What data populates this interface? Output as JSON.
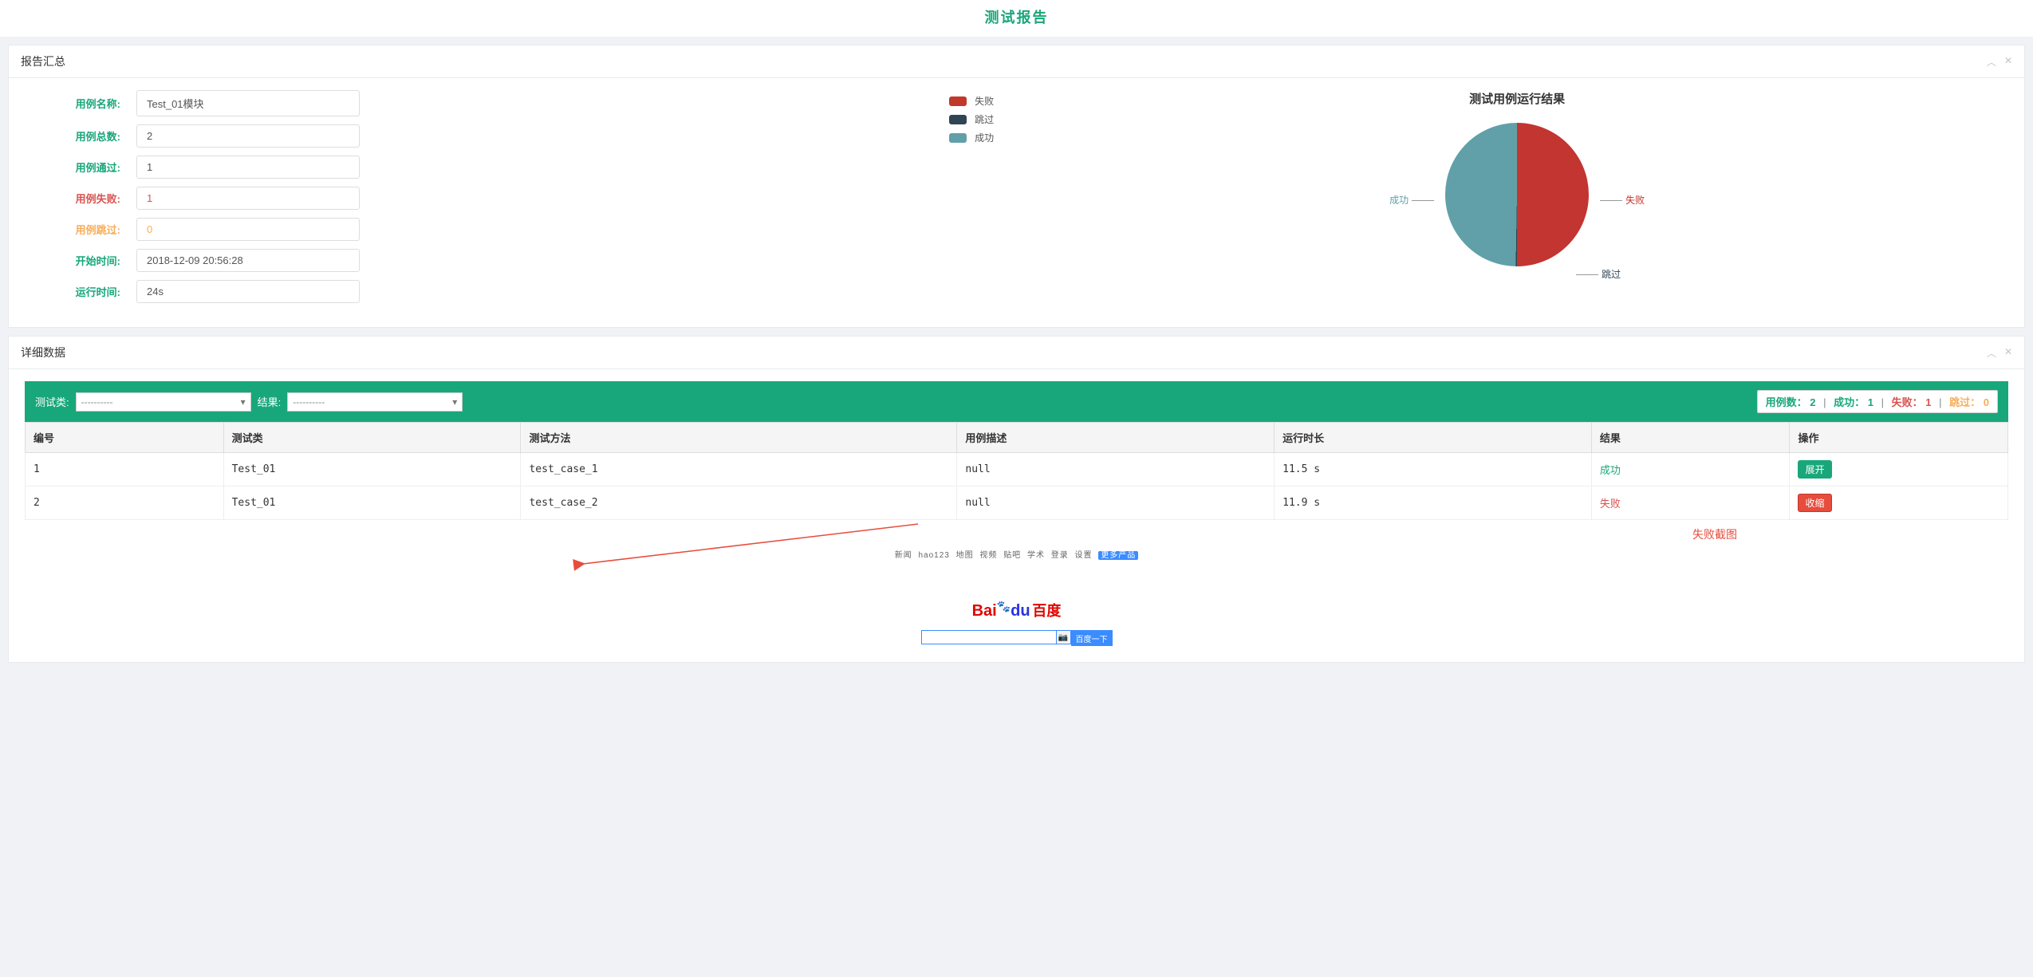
{
  "page_title": "测试报告",
  "panels": {
    "summary": "报告汇总",
    "detail": "详细数据"
  },
  "summary_fields": {
    "case_name": {
      "label": "用例名称:",
      "value": "Test_01模块",
      "label_cls": "lbl-green"
    },
    "case_total": {
      "label": "用例总数:",
      "value": "2",
      "label_cls": "lbl-green"
    },
    "case_pass": {
      "label": "用例通过:",
      "value": "1",
      "label_cls": "lbl-green"
    },
    "case_fail": {
      "label": "用例失败:",
      "value": "1",
      "label_cls": "lbl-red",
      "value_cls": "val-red"
    },
    "case_skip": {
      "label": "用例跳过:",
      "value": "0",
      "label_cls": "lbl-orange",
      "value_cls": "val-orange"
    },
    "start_time": {
      "label": "开始时间:",
      "value": "2018-12-09 20:56:28",
      "label_cls": "lbl-green"
    },
    "run_time": {
      "label": "运行时间:",
      "value": "24s",
      "label_cls": "lbl-green"
    }
  },
  "legend": {
    "fail": "失败",
    "skip": "跳过",
    "pass": "成功"
  },
  "chart": {
    "title": "测试用例运行结果",
    "label_fail": "失败",
    "label_pass": "成功",
    "label_skip": "跳过"
  },
  "chart_data": {
    "type": "pie",
    "title": "测试用例运行结果",
    "series": [
      {
        "name": "失败",
        "value": 1,
        "color": "#c23531"
      },
      {
        "name": "跳过",
        "value": 0,
        "color": "#2f4554"
      },
      {
        "name": "成功",
        "value": 1,
        "color": "#61a0a8"
      }
    ]
  },
  "filters": {
    "class_label": "测试类:",
    "class_placeholder": "----------",
    "result_label": "结果:",
    "result_placeholder": "----------"
  },
  "counters": {
    "total_label": "用例数：",
    "total_value": "2",
    "pass_label": "成功：",
    "pass_value": "1",
    "fail_label": "失败：",
    "fail_value": "1",
    "skip_label": "跳过：",
    "skip_value": "0"
  },
  "table": {
    "headers": {
      "idx": "编号",
      "cls": "测试类",
      "method": "测试方法",
      "desc": "用例描述",
      "duration": "运行时长",
      "result": "结果",
      "action": "操作"
    },
    "rows": [
      {
        "idx": "1",
        "cls": "Test_01",
        "method": "test_case_1",
        "desc": "null",
        "duration": "11.5 s",
        "result": "成功",
        "result_cls": "res-success",
        "action": "展开",
        "action_cls": "btn-teal"
      },
      {
        "idx": "2",
        "cls": "Test_01",
        "method": "test_case_2",
        "desc": "null",
        "duration": "11.9 s",
        "result": "失败",
        "result_cls": "res-fail",
        "action": "收缩",
        "action_cls": "btn-red"
      }
    ]
  },
  "annotation": "失败截图",
  "embedded_shot": {
    "links": [
      "新闻",
      "hao123",
      "地图",
      "视频",
      "贴吧",
      "学术",
      "登录",
      "设置"
    ],
    "links_tag": "更多产品",
    "logo_bai": "Bai",
    "logo_du": "du",
    "logo_cn": "百度",
    "search_btn": "百度一下"
  }
}
